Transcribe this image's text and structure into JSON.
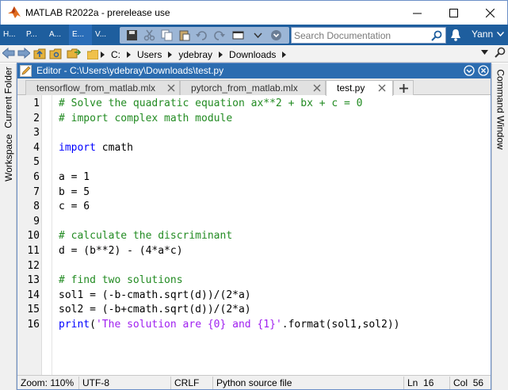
{
  "window": {
    "title": "MATLAB R2022a - prerelease use"
  },
  "ribbon": {
    "tabs": [
      "H...",
      "P...",
      "A...",
      "E...",
      "V..."
    ],
    "search_placeholder": "Search Documentation",
    "user": "Yann"
  },
  "address": {
    "path": [
      "C:",
      "Users",
      "ydebray",
      "Downloads"
    ]
  },
  "dock": {
    "left": [
      "Current Folder",
      "Workspace"
    ],
    "right": [
      "Command Window"
    ]
  },
  "editor": {
    "title": "Editor - C:\\Users\\ydebray\\Downloads\\test.py",
    "tabs": [
      "tensorflow_from_matlab.mlx",
      "pytorch_from_matlab.mlx",
      "test.py"
    ],
    "line_numbers": [
      "1",
      "2",
      "3",
      "4",
      "5",
      "6",
      "7",
      "8",
      "9",
      "10",
      "11",
      "12",
      "13",
      "14",
      "15",
      "16"
    ],
    "code": {
      "l1": "# Solve the quadratic equation ax**2 + bx + c = 0",
      "l2": "# import complex math module",
      "l4_kw": "import",
      "l4_rest": " cmath",
      "l6": "a = 1",
      "l7": "b = 5",
      "l8": "c = 6",
      "l10": "# calculate the discriminant",
      "l11": "d = (b**2) - (4*a*c)",
      "l13": "# find two solutions",
      "l14": "sol1 = (-b-cmath.sqrt(d))/(2*a)",
      "l15": "sol2 = (-b+cmath.sqrt(d))/(2*a)",
      "l16_kw": "print",
      "l16_p1": "(",
      "l16_str": "'The solution are {0} and {1}'",
      "l16_rest": ".format(sol1,sol2))"
    }
  },
  "status": {
    "zoom": "Zoom: 110%",
    "encoding": "UTF-8",
    "eol": "CRLF",
    "filetype": "Python source file",
    "ln_label": "Ln",
    "ln": "16",
    "col_label": "Col",
    "col": "56"
  },
  "colors": {
    "ribbon": "#1e5e9e",
    "editor_title": "#2b6cb0",
    "comment": "#228b22",
    "keyword": "#0000ff",
    "string": "#a020f0"
  }
}
